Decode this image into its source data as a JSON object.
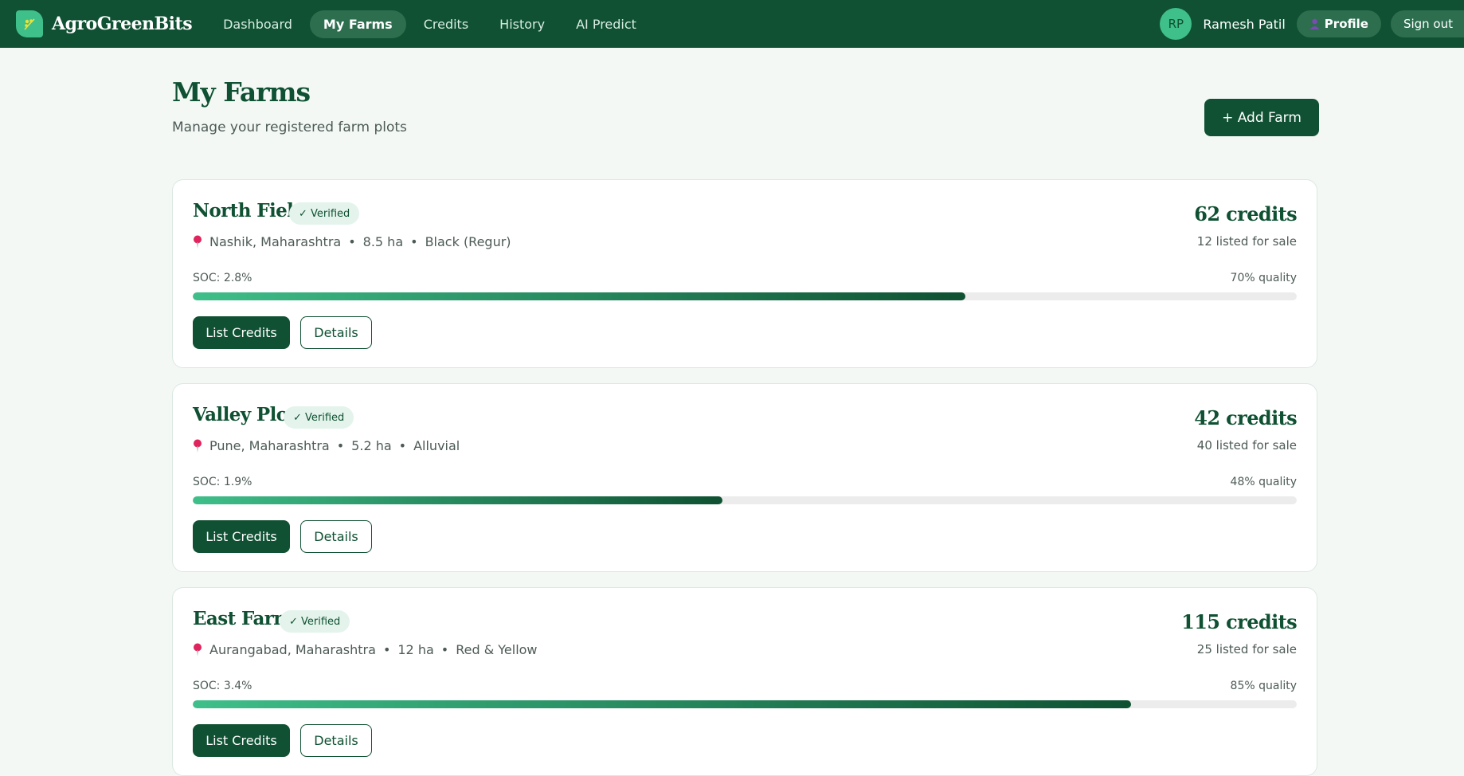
{
  "header": {
    "brand": "AgroGreenBits",
    "nav": [
      {
        "label": "Dashboard",
        "active": false
      },
      {
        "label": "My Farms",
        "active": true
      },
      {
        "label": "Credits",
        "active": false
      },
      {
        "label": "History",
        "active": false
      },
      {
        "label": "AI Predict",
        "active": false
      }
    ],
    "user": {
      "initials": "RP",
      "name": "Ramesh Patil",
      "profile_label": "Profile",
      "signout_label": "Sign out"
    }
  },
  "page": {
    "title": "My Farms",
    "subtitle": "Manage your registered farm plots",
    "add_farm_label": "+ Add Farm"
  },
  "farms": [
    {
      "name": "North Field",
      "verified_label": "✓ Verified",
      "location": "Nashik, Maharashtra",
      "area": "8.5 ha",
      "soil": "Black (Regur)",
      "credits": "62 credits",
      "listed": "12 listed for sale",
      "soc": "SOC: 2.8%",
      "quality": "70% quality",
      "quality_fraction": 0.7,
      "list_label": "List Credits",
      "details_label": "Details"
    },
    {
      "name": "Valley Plot",
      "verified_label": "✓ Verified",
      "location": "Pune, Maharashtra",
      "area": "5.2 ha",
      "soil": "Alluvial",
      "credits": "42 credits",
      "listed": "40 listed for sale",
      "soc": "SOC: 1.9%",
      "quality": "48% quality",
      "quality_fraction": 0.48,
      "list_label": "List Credits",
      "details_label": "Details"
    },
    {
      "name": "East Farm",
      "verified_label": "✓ Verified",
      "location": "Aurangabad, Maharashtra",
      "area": "12 ha",
      "soil": "Red & Yellow",
      "credits": "115 credits",
      "listed": "25 listed for sale",
      "soc": "SOC: 3.4%",
      "quality": "85% quality",
      "quality_fraction": 0.85,
      "list_label": "List Credits",
      "details_label": "Details"
    }
  ],
  "colors": {
    "primary": "#0f5132",
    "accent": "#3fbf8a",
    "background": "#f3f8f5",
    "badge_bg": "#e4f4ec"
  },
  "icons": {
    "brand": "leaf-logo-icon",
    "profile": "person-icon",
    "location": "map-pin-icon"
  }
}
